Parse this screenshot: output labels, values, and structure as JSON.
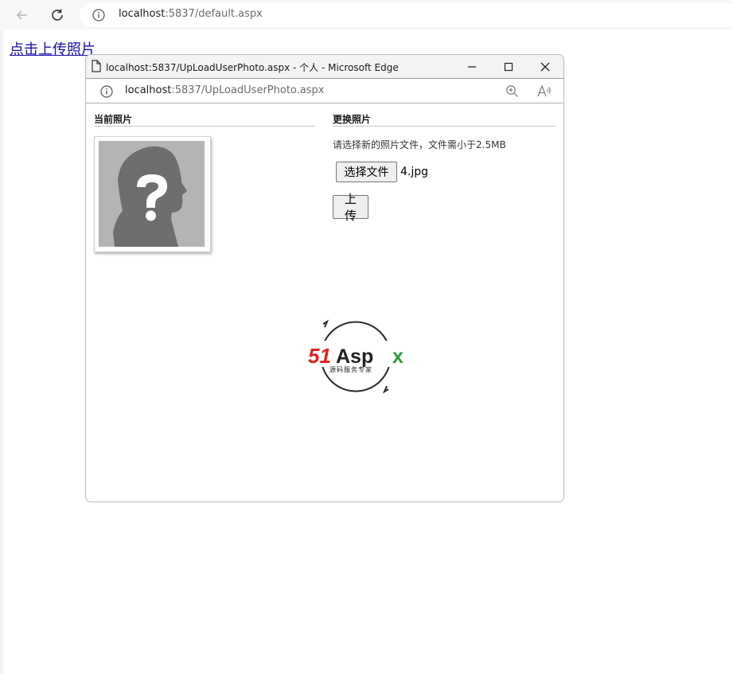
{
  "browser": {
    "url_host": "localhost",
    "url_rest": ":5837/default.aspx"
  },
  "page": {
    "link_text": "点击上传照片"
  },
  "popup": {
    "title": "localhost:5837/UpLoadUserPhoto.aspx - 个人 - Microsoft Edge",
    "url_host": "localhost",
    "url_rest": ":5837/UpLoadUserPhoto.aspx",
    "current_photo_heading": "当前照片",
    "change_photo_heading": "更换照片",
    "hint": "请选择新的照片文件，文件需小于2.5MB",
    "choose_file_label": "选择文件",
    "file_name": "4.jpg",
    "upload_label": "上 传",
    "logo_main": "51Aspx",
    "logo_sub": "源码服务专家"
  },
  "colors": {
    "link": "#1a0dab",
    "logo_red": "#e02020",
    "logo_green": "#2e9a3a",
    "placeholder_bg": "#b4b4b4",
    "placeholder_fg": "#6e6e6e"
  }
}
